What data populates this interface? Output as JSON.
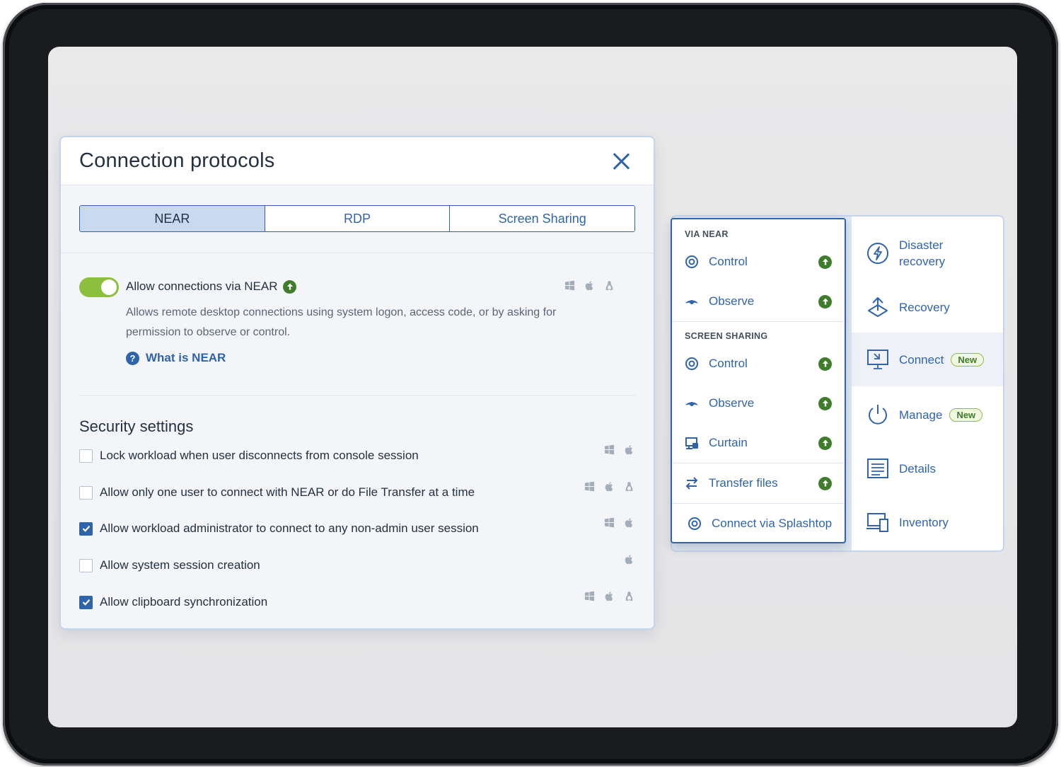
{
  "dialog": {
    "title": "Connection protocols",
    "tabs": [
      "NEAR",
      "RDP",
      "Screen Sharing"
    ],
    "active_tab": "NEAR",
    "near": {
      "toggle_on": true,
      "label": "Allow connections via NEAR",
      "description": "Allows remote desktop connections using system logon, access code, or by asking for permission to observe or control.",
      "help_link": "What is NEAR",
      "os": [
        "windows",
        "apple",
        "linux"
      ]
    },
    "security": {
      "title": "Security settings",
      "items": [
        {
          "label": "Lock workload when user disconnects from console session",
          "checked": false,
          "os": [
            "windows",
            "apple"
          ]
        },
        {
          "label": "Allow only one user to connect with NEAR or do File Transfer at a time",
          "checked": false,
          "os": [
            "windows",
            "apple",
            "linux"
          ]
        },
        {
          "label": "Allow workload administrator to connect to any non-admin user session",
          "checked": true,
          "os": [
            "windows",
            "apple"
          ]
        },
        {
          "label": "Allow system session creation",
          "checked": false,
          "os": [
            "apple"
          ]
        },
        {
          "label": "Allow clipboard synchronization",
          "checked": true,
          "os": [
            "windows",
            "apple",
            "linux"
          ]
        }
      ]
    }
  },
  "connect_menu": {
    "via_near_title": "VIA NEAR",
    "via_near": [
      {
        "label": "Control",
        "icon": "target-icon"
      },
      {
        "label": "Observe",
        "icon": "eye-icon"
      }
    ],
    "screen_sharing_title": "SCREEN SHARING",
    "screen_sharing": [
      {
        "label": "Control",
        "icon": "target-icon"
      },
      {
        "label": "Observe",
        "icon": "eye-icon"
      },
      {
        "label": "Curtain",
        "icon": "curtain-icon"
      }
    ],
    "transfer_files": "Transfer files",
    "splashtop": "Connect via Splashtop"
  },
  "side_menu": {
    "items": [
      {
        "label": "Disaster recovery",
        "icon": "lightning-icon"
      },
      {
        "label": "Recovery",
        "icon": "recovery-icon"
      },
      {
        "label": "Connect",
        "icon": "connect-icon",
        "badge": "New"
      },
      {
        "label": "Manage",
        "icon": "power-icon",
        "badge": "New"
      },
      {
        "label": "Details",
        "icon": "details-icon"
      },
      {
        "label": "Inventory",
        "icon": "inventory-icon"
      }
    ]
  },
  "colors": {
    "accent": "#2f64ad",
    "toggle_on": "#8dbf3f",
    "badge_green": "#3f7d2a",
    "tab_active": "#c9d9f0"
  }
}
